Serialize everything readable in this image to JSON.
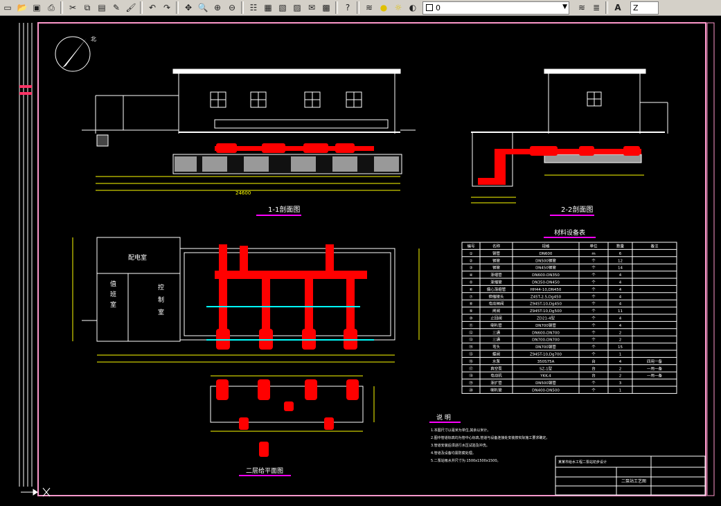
{
  "toolbar": {
    "icons": [
      "new-icon",
      "open-icon",
      "save-icon",
      "print-icon",
      "cut-icon",
      "copy-icon",
      "paste-icon",
      "matchprop-icon",
      "brush-icon",
      "undo-icon",
      "redo-icon",
      "pan-icon",
      "zoom-realtime-icon",
      "zoom-window-icon",
      "zoom-previous-icon",
      "properties-icon",
      "design-center-icon",
      "tool-palette-icon",
      "sheetset-icon",
      "markup-icon",
      "calculator-icon",
      "help-icon"
    ],
    "layer_value": "0",
    "text_style_value": "Z"
  },
  "drawing": {
    "section_1_title": "1-1剖面图",
    "section_2_title": "2-2剖面图",
    "plan_title": "二层给平面图",
    "materials_title": "材料设备表",
    "notes_title": "说 明",
    "room_1": "配电室",
    "room_2": "值",
    "room_3": "班",
    "room_4": "室",
    "room_5": "控",
    "room_6": "制",
    "room_7": "室",
    "overall_dim": "24600",
    "compass_label": "北",
    "title_block_drawing_name": "二泵站工艺图",
    "title_block_project": "某某市给水工程二泵站初步设计"
  },
  "materials_table": {
    "headers": [
      "编号",
      "名称",
      "规格",
      "单位",
      "数量",
      "备注"
    ],
    "rows": [
      [
        "①",
        "钢管",
        "DN600",
        "m",
        "6",
        ""
      ],
      [
        "②",
        "钢管",
        "DN500钢管",
        "个",
        "12",
        ""
      ],
      [
        "③",
        "钢管",
        "DN450钢管",
        "个",
        "14",
        ""
      ],
      [
        "④",
        "渐缩管",
        "DN600-DN350",
        "个",
        "4",
        ""
      ],
      [
        "⑤",
        "渐缩管",
        "DN350-DN450",
        "个",
        "4",
        ""
      ],
      [
        "⑥",
        "偏心渐缩管",
        "HH44-10,DN450",
        "个",
        "4",
        ""
      ],
      [
        "⑦",
        "伸缩接头",
        "Z45T-2.5,Dg450",
        "个",
        "4",
        ""
      ],
      [
        "⑧",
        "电动闸阀",
        "Z945T-10,Dg450",
        "个",
        "4",
        ""
      ],
      [
        "⑨",
        "闸阀",
        "Z945T-10,Dg500",
        "个",
        "11",
        ""
      ],
      [
        "⑩",
        "止回阀",
        "ZD21-4型",
        "个",
        "4",
        ""
      ],
      [
        "⑪",
        "喇叭管",
        "DN700钢管",
        "个",
        "4",
        ""
      ],
      [
        "⑫",
        "三通",
        "DN600-DN700",
        "个",
        "2",
        ""
      ],
      [
        "⑬",
        "三通",
        "DN700-DN700",
        "个",
        "2",
        ""
      ],
      [
        "⑭",
        "弯头",
        "DN700钢管",
        "个",
        "15",
        ""
      ],
      [
        "⑮",
        "蝶阀",
        "Z945T-10,Dg700",
        "个",
        "1",
        ""
      ],
      [
        "⑯",
        "水泵",
        "350S75A",
        "台",
        "4",
        "四用一备"
      ],
      [
        "⑰",
        "真空泵",
        "SZ-1型",
        "台",
        "2",
        "一用一备"
      ],
      [
        "⑱",
        "电动机",
        "YKK-4",
        "台",
        "2",
        "一用一备"
      ],
      [
        "⑲",
        "渐扩管",
        "DN500钢管",
        "个",
        "3",
        ""
      ],
      [
        "⑳",
        "喇叭管",
        "DN400-DN500",
        "个",
        "1",
        ""
      ]
    ]
  },
  "notes": [
    "1.本图尺寸以毫米为单位,其余以米计。",
    "2.图中管道标高均为管中心标高,管道与设备连接处安装按实际施工要求确定。",
    "3.管道安装后须进行水压试验及冲洗。",
    "4.管道及设备均需防腐处理。",
    "5.二泵站吸水井尺寸为:1500x1500x1500。"
  ],
  "colors": {
    "background": "#000000",
    "frame": "#ff99cc",
    "line": "#ffffff",
    "pipe": "#ff0000",
    "dimension": "#ffff00",
    "magenta": "#ff00ff",
    "cyan": "#00ffff",
    "green": "#00ff00"
  }
}
